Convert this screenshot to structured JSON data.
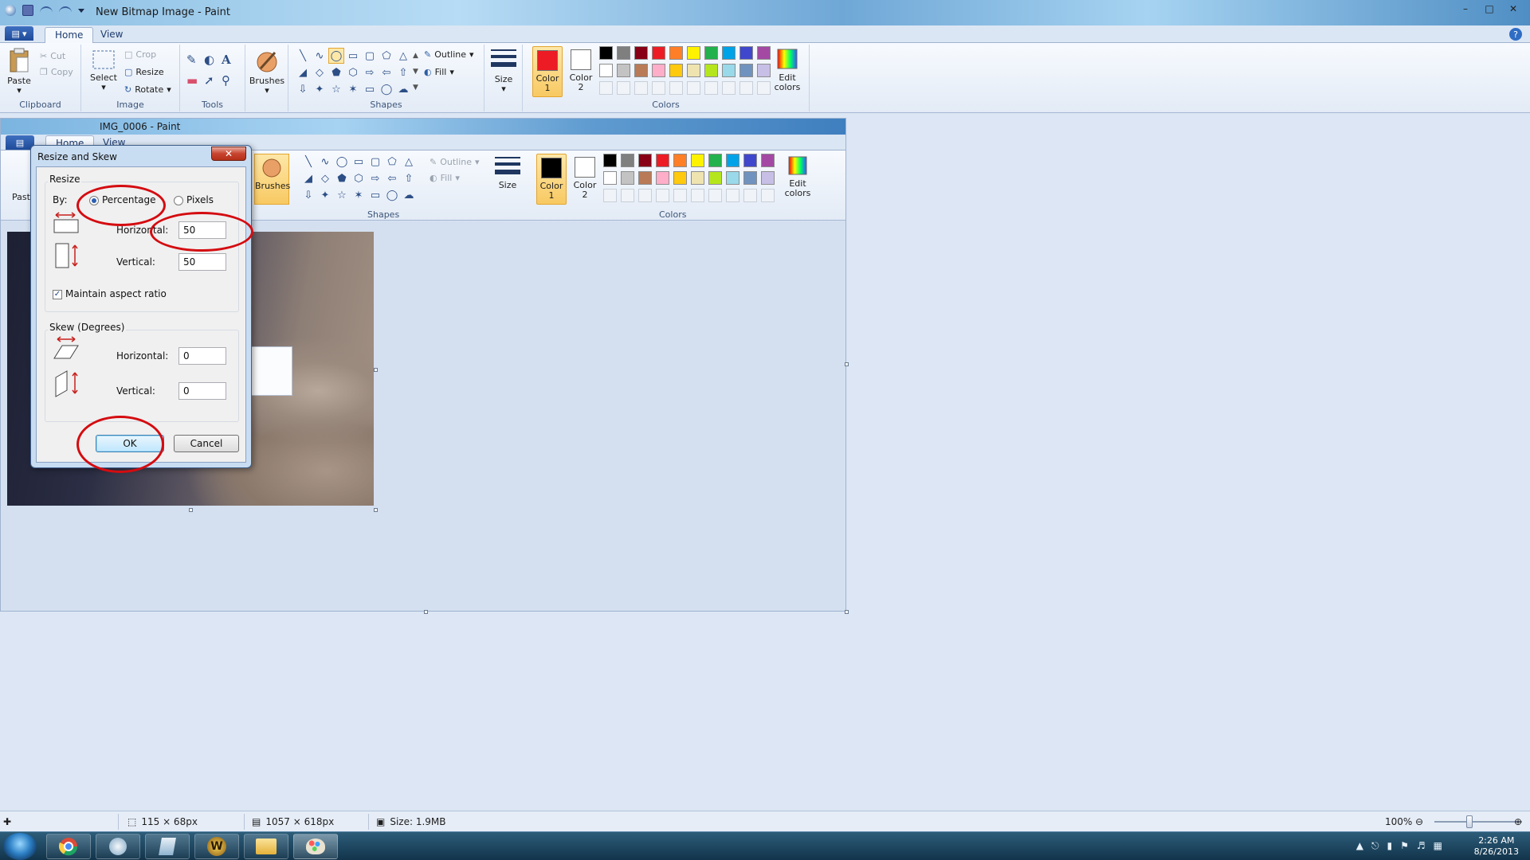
{
  "window": {
    "title": "New Bitmap Image - Paint",
    "min": "–",
    "max": "□",
    "close": "✕"
  },
  "tabs": {
    "home": "Home",
    "view": "View"
  },
  "ribbon": {
    "clipboard": {
      "label": "Clipboard",
      "paste": "Paste",
      "cut": "Cut",
      "copy": "Copy"
    },
    "image": {
      "label": "Image",
      "select": "Select",
      "crop": "Crop",
      "resize": "Resize",
      "rotate": "Rotate"
    },
    "tools": {
      "label": "Tools"
    },
    "brushes": "Brushes",
    "shapes": {
      "label": "Shapes",
      "outline": "Outline",
      "fill": "Fill"
    },
    "size": "Size",
    "colors": {
      "label": "Colors",
      "color1": "Color 1",
      "color2": "Color 2",
      "edit": "Edit colors",
      "color1_value": "#ed1c24",
      "color2_value": "#ffffff",
      "row1": [
        "#000000",
        "#7f7f7f",
        "#880015",
        "#ed1c24",
        "#ff7f27",
        "#fff200",
        "#22b14c",
        "#00a2e8",
        "#3f48cc",
        "#a349a4"
      ],
      "row2": [
        "#ffffff",
        "#c3c3c3",
        "#b97a57",
        "#ffaec9",
        "#ffc90e",
        "#efe4b0",
        "#b5e61d",
        "#99d9ea",
        "#7092be",
        "#c8bfe7"
      ]
    }
  },
  "inner": {
    "title": "IMG_0006 - Paint",
    "tabs": {
      "home": "Home",
      "view": "View"
    },
    "brushes": "Brushes",
    "outline": "Outline",
    "fill": "Fill",
    "size": "Size",
    "shapes_label": "Shapes",
    "colors_label": "Colors",
    "color1": "Color 1",
    "color2": "Color 2",
    "edit": "Edit colors",
    "paste": "Paste",
    "color1_value": "#000000",
    "color2_value": "#ffffff"
  },
  "dialog": {
    "title": "Resize and Skew",
    "close": "✕",
    "resize_legend": "Resize",
    "by": "By:",
    "percentage": "Percentage",
    "pixels": "Pixels",
    "horizontal_label": "Horizontal:",
    "vertical_label": "Vertical:",
    "horizontal_value": "50",
    "vertical_value": "50",
    "maintain": "Maintain aspect ratio",
    "skew_legend": "Skew (Degrees)",
    "skew_horizontal_label": "Horizontal:",
    "skew_vertical_label": "Vertical:",
    "skew_horizontal_value": "0",
    "skew_vertical_value": "0",
    "ok": "OK",
    "cancel": "Cancel"
  },
  "status": {
    "selection": "115 × 68px",
    "canvas": "1057 × 618px",
    "size": "Size: 1.9MB",
    "zoom": "100%"
  },
  "tray": {
    "time": "2:26 AM",
    "date": "8/26/2013"
  }
}
